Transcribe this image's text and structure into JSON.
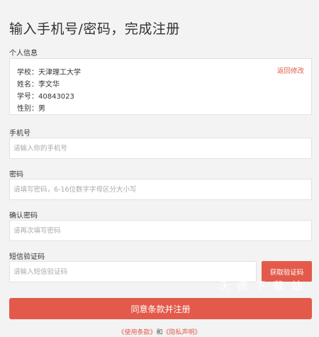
{
  "page": {
    "title": "输入手机号/密码，完成注册"
  },
  "personal_info": {
    "label": "个人信息",
    "back_link": "返回修改",
    "lines": [
      "学校：天津理工大学",
      "姓名：李文华",
      "学号：40843023",
      "性别：男"
    ]
  },
  "phone": {
    "label": "手机号",
    "placeholder": "请输入你的手机号",
    "value": ""
  },
  "password": {
    "label": "密码",
    "placeholder": "请填写密码，6-16位数字字母区分大小写",
    "value": ""
  },
  "confirm_password": {
    "label": "确认密码",
    "placeholder": "请再次填写密码",
    "value": ""
  },
  "sms_code": {
    "label": "短信验证码",
    "placeholder": "请输入短信验证码",
    "value": "",
    "button_label": "获取验证码"
  },
  "submit": {
    "label": "同意条款并注册"
  },
  "terms": {
    "terms_link": "《使用条款》",
    "and_text": "和",
    "privacy_link": "《隐私声明》"
  },
  "watermark": {
    "text": "沃 德 下 载 站"
  },
  "colors": {
    "accent": "#e35a4a",
    "background": "#f3f3f3"
  }
}
